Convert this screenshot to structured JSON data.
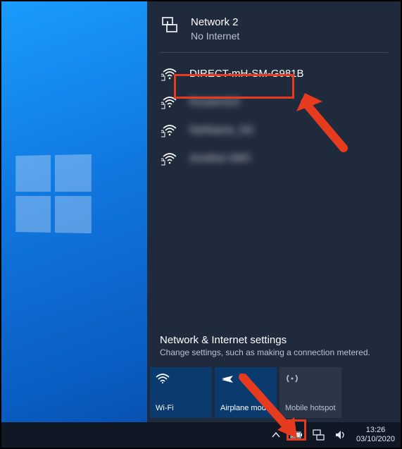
{
  "connected": {
    "name": "Network 2",
    "status": "No Internet"
  },
  "networks": [
    {
      "ssid": "DIRECT-mH-SM-G981B",
      "secured": true,
      "highlighted": true,
      "blurred": false
    },
    {
      "ssid": "RouterA24",
      "secured": true,
      "highlighted": false,
      "blurred": true
    },
    {
      "ssid": "NetName_5G",
      "secured": true,
      "highlighted": false,
      "blurred": true
    },
    {
      "ssid": "Another-WiFi",
      "secured": true,
      "highlighted": false,
      "blurred": true
    }
  ],
  "settings": {
    "title": "Network & Internet settings",
    "subtitle": "Change settings, such as making a connection metered."
  },
  "tiles": {
    "wifi": "Wi-Fi",
    "airplane": "Airplane mode",
    "hotspot": "Mobile hotspot"
  },
  "tray": {
    "time": "13:26",
    "date": "03/10/2020"
  }
}
